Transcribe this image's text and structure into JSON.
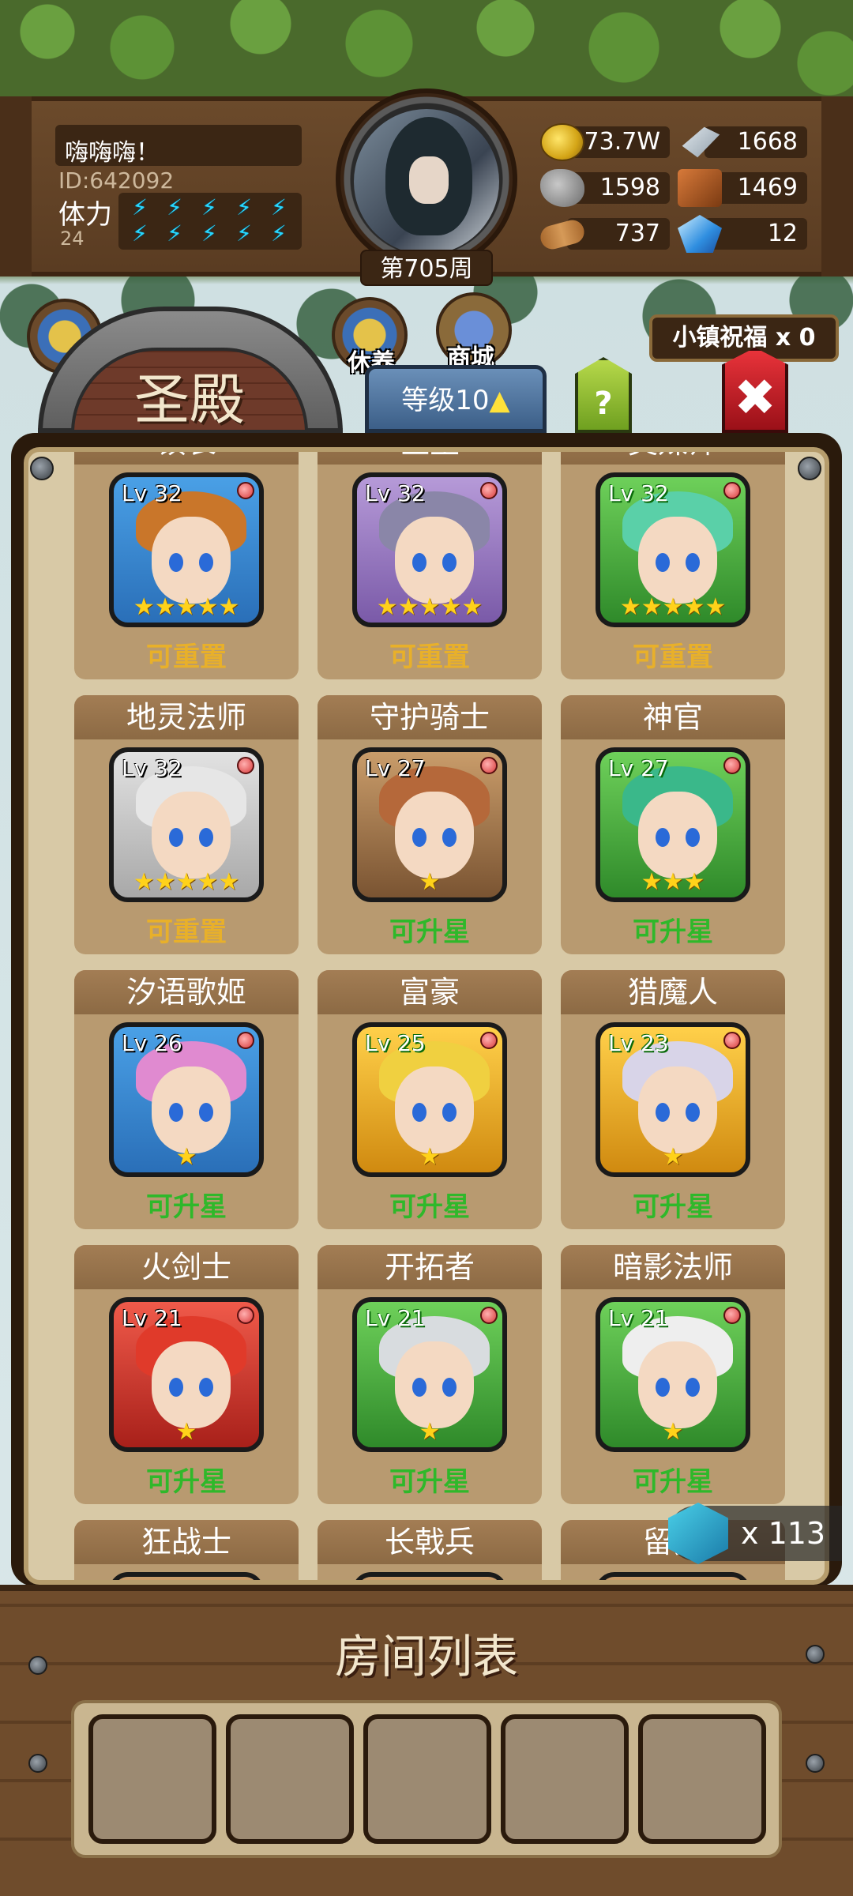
{
  "player": {
    "name": "嗨嗨嗨！",
    "id": "ID:642092",
    "stamina_label": "体力",
    "stamina_value": "24",
    "stamina_bolts": 10,
    "week": "第705周"
  },
  "resources": {
    "gold": "173.7W",
    "iron": "1668",
    "stone": "1598",
    "leather": "1469",
    "wood": "737",
    "crystal": "12"
  },
  "nav": {
    "rest_label": "休养",
    "shop_label": "商城",
    "blessing": "小镇祝福 x 0"
  },
  "temple": {
    "title": "圣殿",
    "level_text": "等级10",
    "help_text": "?",
    "close_text": "✖"
  },
  "heroes": [
    {
      "name": "镇长",
      "level": "Lv 32",
      "rarity": "blue",
      "stars": 5,
      "status": "可重置",
      "status_type": "reset",
      "hair": "#c9762a"
    },
    {
      "name": "医生",
      "level": "Lv 32",
      "rarity": "purple",
      "stars": 5,
      "status": "可重置",
      "status_type": "reset",
      "hair": "#8a86a8"
    },
    {
      "name": "灵媒师",
      "level": "Lv 32",
      "rarity": "green",
      "stars": 5,
      "status": "可重置",
      "status_type": "reset",
      "hair": "#5ad0a8"
    },
    {
      "name": "地灵法师",
      "level": "Lv 32",
      "rarity": "white",
      "stars": 5,
      "status": "可重置",
      "status_type": "reset",
      "hair": "#e6e6e6"
    },
    {
      "name": "守护骑士",
      "level": "Lv 27",
      "rarity": "brown",
      "stars": 1,
      "status": "可升星",
      "status_type": "upstar",
      "hair": "#b5683a"
    },
    {
      "name": "神官",
      "level": "Lv 27",
      "rarity": "green",
      "stars": 3,
      "status": "可升星",
      "status_type": "upstar",
      "hair": "#3ab88a"
    },
    {
      "name": "汐语歌姬",
      "level": "Lv 26",
      "rarity": "blue",
      "stars": 1,
      "status": "可升星",
      "status_type": "upstar",
      "hair": "#e08ad0"
    },
    {
      "name": "富豪",
      "level": "Lv 25",
      "rarity": "gold",
      "stars": 1,
      "status": "可升星",
      "status_type": "upstar",
      "hair": "#f0d040"
    },
    {
      "name": "猎魔人",
      "level": "Lv 23",
      "rarity": "gold",
      "stars": 1,
      "status": "可升星",
      "status_type": "upstar",
      "hair": "#d8d4e8"
    },
    {
      "name": "火剑士",
      "level": "Lv 21",
      "rarity": "red",
      "stars": 1,
      "status": "可升星",
      "status_type": "upstar",
      "hair": "#e03a2a"
    },
    {
      "name": "开拓者",
      "level": "Lv 21",
      "rarity": "green",
      "stars": 1,
      "status": "可升星",
      "status_type": "upstar",
      "hair": "#d8dcdf"
    },
    {
      "name": "暗影法师",
      "level": "Lv 21",
      "rarity": "green",
      "stars": 1,
      "status": "可升星",
      "status_type": "upstar",
      "hair": "#eeeeee"
    },
    {
      "name": "狂战士",
      "level": "",
      "rarity": "brown",
      "stars": 0,
      "status": "",
      "status_type": "",
      "hair": "#888888"
    },
    {
      "name": "长戟兵",
      "level": "",
      "rarity": "brown",
      "stars": 0,
      "status": "",
      "status_type": "",
      "hair": "#888888"
    },
    {
      "name": "留梦",
      "level": "",
      "rarity": "brown",
      "stars": 0,
      "status": "",
      "status_type": "",
      "hair": "#888888"
    }
  ],
  "token_count": "x 113",
  "room": {
    "title": "房间列表",
    "slots": 5
  }
}
